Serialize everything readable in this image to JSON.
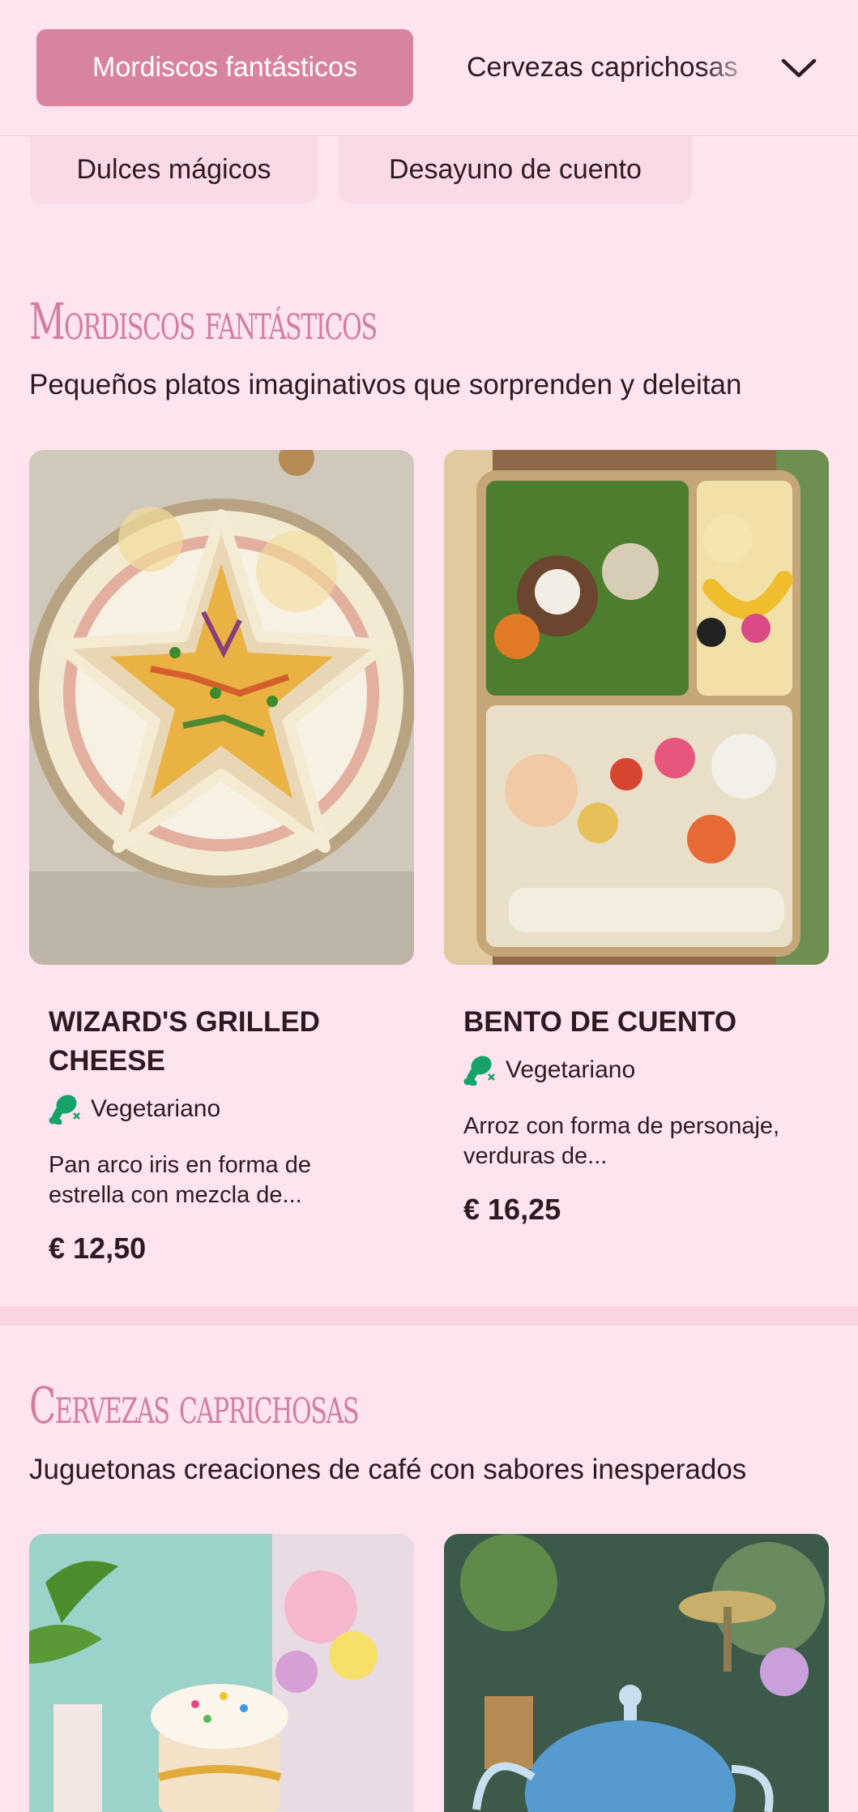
{
  "nav": {
    "active_tab": "Mordiscos fantásticos",
    "next_tab": "Cervezas caprichosas",
    "expand_icon": "chevron-down-icon",
    "pills": [
      "Dulces mágicos",
      "Desayuno de cuento"
    ]
  },
  "colors": {
    "background": "#fde4ee",
    "accent": "#d9849f",
    "title": "#d27f9c",
    "veg_icon": "#16a36a"
  },
  "sections": [
    {
      "title": "Mordiscos fantásticos",
      "subtitle": "Pequeños platos imaginativos que sorprenden y deleitan",
      "items": [
        {
          "name": "WIZARD'S GRILLED CHEESE",
          "tag": "Vegetariano",
          "tag_icon": "no-meat-icon",
          "description": "Pan arco iris en forma de estrella con mezcla de...",
          "price": "€ 12,50",
          "image": "star-sandwich-photo"
        },
        {
          "name": "BENTO DE CUENTO",
          "tag": "Vegetariano",
          "tag_icon": "no-meat-icon",
          "description": "Arroz con forma de personaje, verduras de...",
          "price": "€ 16,25",
          "image": "character-bento-photo"
        }
      ]
    },
    {
      "title": "Cervezas caprichosas",
      "subtitle": "Juguetonas creaciones de café con sabores inesperados",
      "items": [
        {
          "image": "sprinkle-latte-photo"
        },
        {
          "image": "blue-tea-pot-photo"
        }
      ]
    }
  ]
}
